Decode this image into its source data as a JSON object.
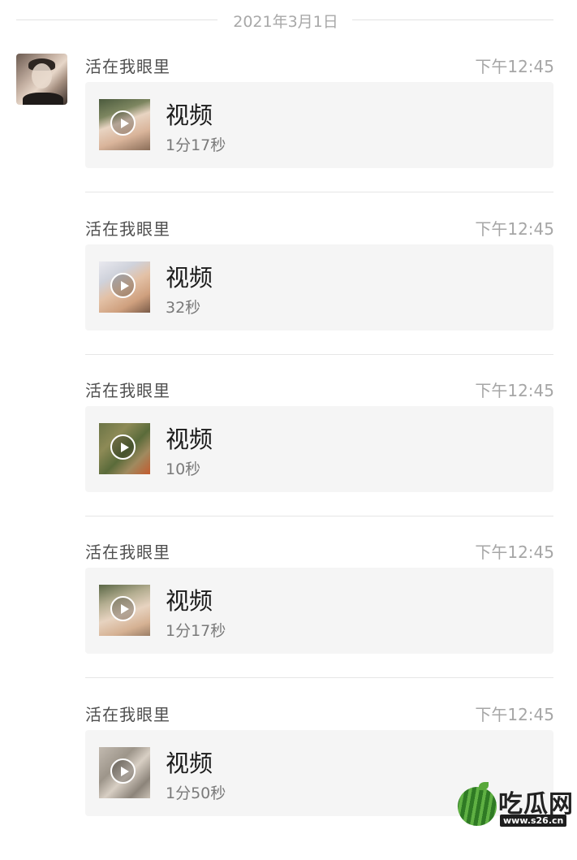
{
  "date_divider": "2021年3月1日",
  "messages": [
    {
      "sender": "活在我眼里",
      "time": "下午12:45",
      "title": "视频",
      "duration": "1分17秒"
    },
    {
      "sender": "活在我眼里",
      "time": "下午12:45",
      "title": "视频",
      "duration": "32秒"
    },
    {
      "sender": "活在我眼里",
      "time": "下午12:45",
      "title": "视频",
      "duration": "10秒"
    },
    {
      "sender": "活在我眼里",
      "time": "下午12:45",
      "title": "视频",
      "duration": "1分17秒"
    },
    {
      "sender": "活在我眼里",
      "time": "下午12:45",
      "title": "视频",
      "duration": "1分50秒"
    }
  ],
  "icons": {
    "play": "play-icon",
    "avatar": "avatar"
  },
  "watermark": {
    "text": "吃瓜网",
    "url": "www.s26.cn"
  },
  "colors": {
    "card_bg": "#f5f5f5",
    "muted_text": "#a6a6a6",
    "divider": "#e6e6e6"
  }
}
